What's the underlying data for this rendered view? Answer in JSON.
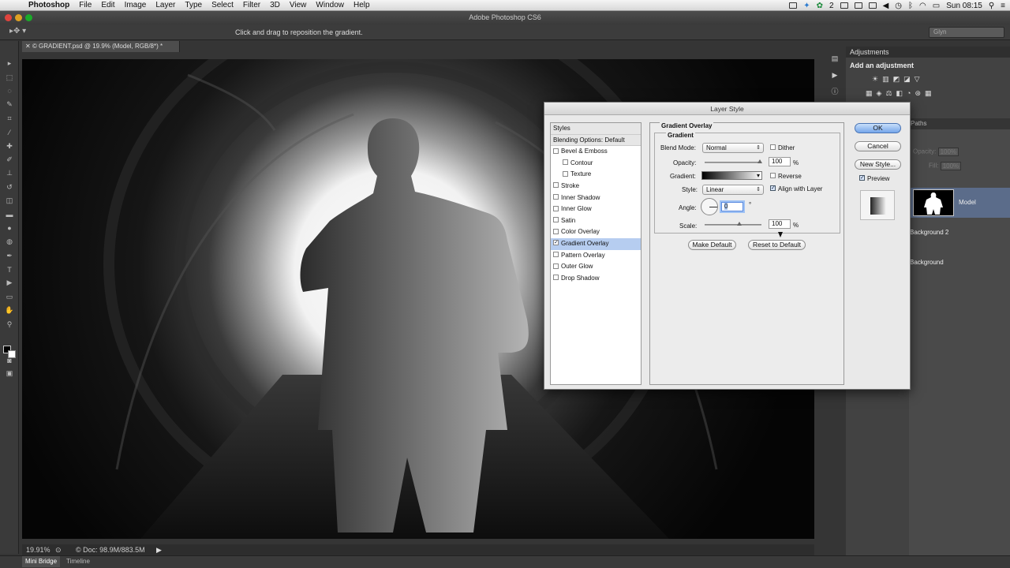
{
  "menubar": {
    "apple": "",
    "items": [
      "Photoshop",
      "File",
      "Edit",
      "Image",
      "Layer",
      "Type",
      "Select",
      "Filter",
      "3D",
      "View",
      "Window",
      "Help"
    ],
    "status_num": "2",
    "clock": "Sun 08:15"
  },
  "window": {
    "title": "Adobe Photoshop CS6"
  },
  "options": {
    "hint": "Click and drag to reposition the gradient.",
    "workspace": "Glyn"
  },
  "document": {
    "tab": "© GRADIENT.psd @ 19.9% (Model, RGB/8*) *"
  },
  "status": {
    "zoom": "19.91%",
    "doc": "Doc: 98.9M/883.5M"
  },
  "bottom_tabs": [
    "Mini Bridge",
    "Timeline"
  ],
  "adjustments": {
    "tab": "Adjustments",
    "add_label": "Add an adjustment"
  },
  "layers": {
    "paths_tab": "Paths",
    "opacity_label": "Opacity:",
    "opacity_value": "100%",
    "fill_label": "Fill:",
    "fill_value": "100%",
    "items": [
      "Model",
      "Background 2",
      "Background"
    ]
  },
  "dialog": {
    "title": "Layer Style",
    "styles_header": "Styles",
    "blending": "Blending Options: Default",
    "style_items": [
      {
        "label": "Bevel & Emboss",
        "checked": false,
        "indent": false,
        "selected": false
      },
      {
        "label": "Contour",
        "checked": false,
        "indent": true,
        "selected": false
      },
      {
        "label": "Texture",
        "checked": false,
        "indent": true,
        "selected": false
      },
      {
        "label": "Stroke",
        "checked": false,
        "indent": false,
        "selected": false
      },
      {
        "label": "Inner Shadow",
        "checked": false,
        "indent": false,
        "selected": false
      },
      {
        "label": "Inner Glow",
        "checked": false,
        "indent": false,
        "selected": false
      },
      {
        "label": "Satin",
        "checked": false,
        "indent": false,
        "selected": false
      },
      {
        "label": "Color Overlay",
        "checked": false,
        "indent": false,
        "selected": false
      },
      {
        "label": "Gradient Overlay",
        "checked": true,
        "indent": false,
        "selected": true
      },
      {
        "label": "Pattern Overlay",
        "checked": false,
        "indent": false,
        "selected": false
      },
      {
        "label": "Outer Glow",
        "checked": false,
        "indent": false,
        "selected": false
      },
      {
        "label": "Drop Shadow",
        "checked": false,
        "indent": false,
        "selected": false
      }
    ],
    "section_title": "Gradient Overlay",
    "group_title": "Gradient",
    "blend_mode_label": "Blend Mode:",
    "blend_mode_value": "Normal",
    "dither_label": "Dither",
    "opacity_label": "Opacity:",
    "opacity_value": "100",
    "percent": "%",
    "gradient_label": "Gradient:",
    "reverse_label": "Reverse",
    "style_label": "Style:",
    "style_value": "Linear",
    "align_label": "Align with Layer",
    "angle_label": "Angle:",
    "angle_value": "0",
    "degree": "°",
    "scale_label": "Scale:",
    "scale_value": "100",
    "make_default": "Make Default",
    "reset_default": "Reset to Default",
    "ok": "OK",
    "cancel": "Cancel",
    "new_style": "New Style...",
    "preview": "Preview"
  },
  "colors": {
    "accent": "#75a6ea",
    "selection": "#b6cdf0",
    "layer_selected": "#5b6c8a"
  }
}
